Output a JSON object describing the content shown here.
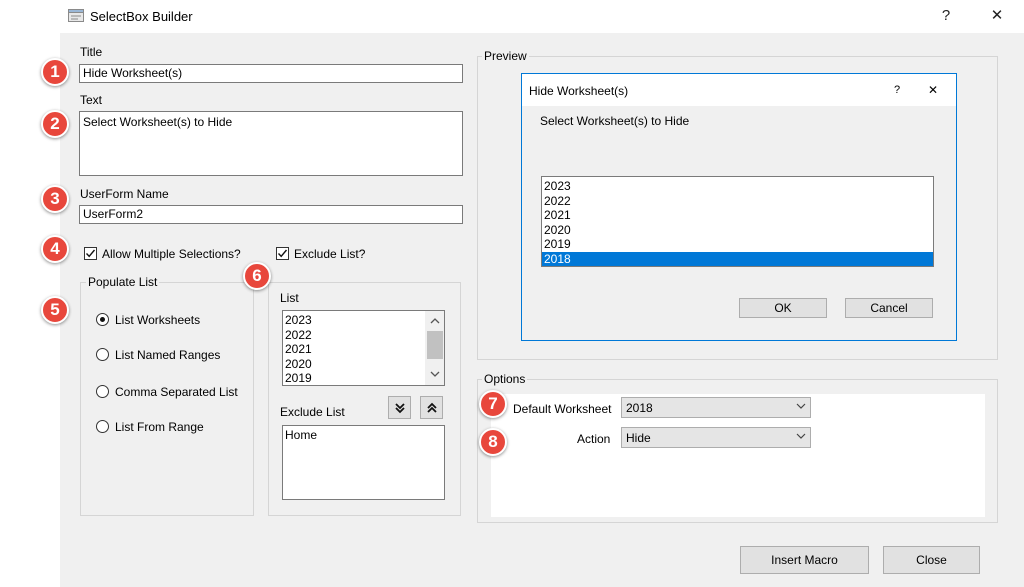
{
  "window": {
    "title": "SelectBox Builder",
    "help_label": "?",
    "close_label": "✕"
  },
  "fields": {
    "title_label": "Title",
    "title_value": "Hide Worksheet(s)",
    "text_label": "Text",
    "text_value": "Select Worksheet(s) to Hide",
    "userform_label": "UserForm Name",
    "userform_value": "UserForm2"
  },
  "checkboxes": {
    "allow_multiple_label": "Allow Multiple Selections?",
    "allow_multiple_checked": true,
    "exclude_list_label": "Exclude List?",
    "exclude_list_checked": true
  },
  "populate": {
    "group_title": "Populate List",
    "options": [
      {
        "label": "List Worksheets",
        "selected": true
      },
      {
        "label": "List Named Ranges",
        "selected": false
      },
      {
        "label": "Comma Separated List",
        "selected": false
      },
      {
        "label": "List From Range",
        "selected": false
      }
    ]
  },
  "list_panel": {
    "list_label": "List",
    "items": [
      "2023",
      "2022",
      "2021",
      "2020",
      "2019"
    ],
    "exclude_label": "Exclude List",
    "exclude_items": [
      "Home"
    ]
  },
  "preview": {
    "group_title": "Preview",
    "dialog_title": "Hide Worksheet(s)",
    "help_label": "?",
    "close_label": "✕",
    "prompt": "Select Worksheet(s) to Hide",
    "items": [
      "2023",
      "2022",
      "2021",
      "2020",
      "2019",
      "2018"
    ],
    "selected_item": "2018",
    "ok_label": "OK",
    "cancel_label": "Cancel"
  },
  "options": {
    "group_title": "Options",
    "default_ws_label": "Default Worksheet",
    "default_ws_value": "2018",
    "action_label": "Action",
    "action_value": "Hide"
  },
  "buttons": {
    "insert_macro": "Insert Macro",
    "close": "Close"
  },
  "badges": [
    "1",
    "2",
    "3",
    "4",
    "5",
    "6",
    "7",
    "8"
  ],
  "colors": {
    "badge": "#e8473c",
    "selection": "#0078d7",
    "preview_border": "#0078d7"
  }
}
